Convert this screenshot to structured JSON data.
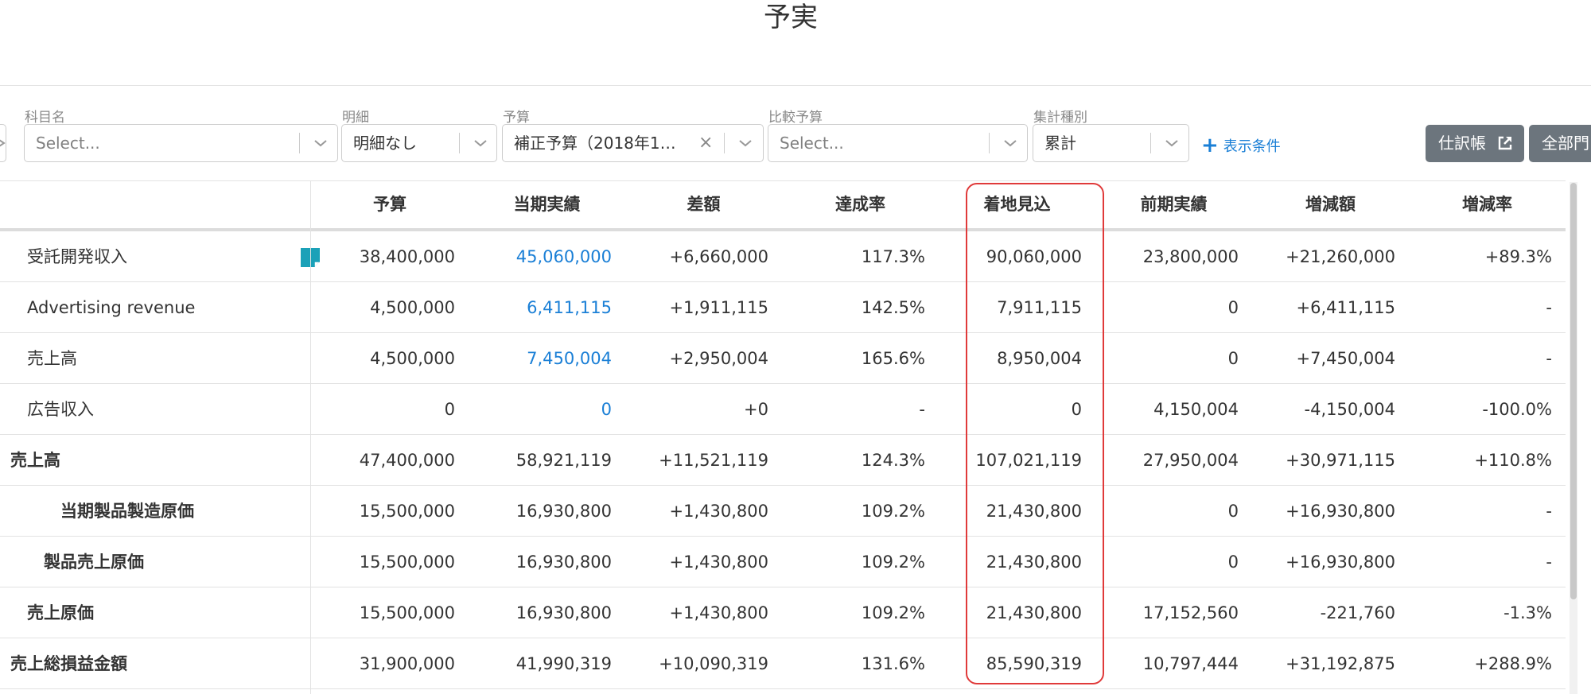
{
  "page": {
    "title": "予実"
  },
  "filters": {
    "account_name": {
      "label": "科目名",
      "placeholder": "Select..."
    },
    "detail": {
      "label": "明細",
      "value": "明細なし"
    },
    "budget": {
      "label": "予算",
      "value": "補正予算（2018年1…"
    },
    "compare_budget": {
      "label": "比較予算",
      "placeholder": "Select..."
    },
    "aggregation": {
      "label": "集計種別",
      "value": "累計"
    },
    "conditions_link": "表示条件"
  },
  "buttons": {
    "journal": "仕訳帳",
    "all_departments": "全部門"
  },
  "table": {
    "columns": [
      "予算",
      "当期実績",
      "差額",
      "達成率",
      "着地見込",
      "前期実績",
      "増減額",
      "増減率"
    ],
    "rows": [
      {
        "name": "受託開発収入",
        "has_note": true,
        "budget": "38,400,000",
        "actual": "45,060,000",
        "actual_link": true,
        "diff": "+6,660,000",
        "rate": "117.3%",
        "forecast": "90,060,000",
        "prev": "23,800,000",
        "change": "+21,260,000",
        "change_rate": "+89.3%"
      },
      {
        "name": "Advertising revenue",
        "budget": "4,500,000",
        "actual": "6,411,115",
        "actual_link": true,
        "diff": "+1,911,115",
        "rate": "142.5%",
        "forecast": "7,911,115",
        "prev": "0",
        "change": "+6,411,115",
        "change_rate": "-"
      },
      {
        "name": "売上高",
        "budget": "4,500,000",
        "actual": "7,450,004",
        "actual_link": true,
        "diff": "+2,950,004",
        "rate": "165.6%",
        "forecast": "8,950,004",
        "prev": "0",
        "change": "+7,450,004",
        "change_rate": "-"
      },
      {
        "name": "広告収入",
        "budget": "0",
        "actual": "0",
        "actual_link": true,
        "diff": "+0",
        "rate": "-",
        "forecast": "0",
        "prev": "4,150,004",
        "change": "-4,150,004",
        "change_rate": "-100.0%"
      },
      {
        "name": "売上高",
        "bold": true,
        "budget": "47,400,000",
        "actual": "58,921,119",
        "diff": "+11,521,119",
        "rate": "124.3%",
        "forecast": "107,021,119",
        "prev": "27,950,004",
        "change": "+30,971,115",
        "change_rate": "+110.8%"
      },
      {
        "name": "当期製品製造原価",
        "bold": true,
        "budget": "15,500,000",
        "actual": "16,930,800",
        "diff": "+1,430,800",
        "rate": "109.2%",
        "forecast": "21,430,800",
        "prev": "0",
        "change": "+16,930,800",
        "change_rate": "-"
      },
      {
        "name": "製品売上原価",
        "bold": true,
        "budget": "15,500,000",
        "actual": "16,930,800",
        "diff": "+1,430,800",
        "rate": "109.2%",
        "forecast": "21,430,800",
        "prev": "0",
        "change": "+16,930,800",
        "change_rate": "-"
      },
      {
        "name": "売上原価",
        "bold": true,
        "budget": "15,500,000",
        "actual": "16,930,800",
        "diff": "+1,430,800",
        "rate": "109.2%",
        "forecast": "21,430,800",
        "prev": "17,152,560",
        "change": "-221,760",
        "change_rate": "-1.3%"
      },
      {
        "name": "売上総損益金額",
        "bold": true,
        "budget": "31,900,000",
        "actual": "41,990,319",
        "diff": "+10,090,319",
        "rate": "131.6%",
        "forecast": "85,590,319",
        "prev": "10,797,444",
        "change": "+31,192,875",
        "change_rate": "+288.9%"
      }
    ]
  },
  "colors": {
    "link": "#1a7fd6",
    "highlight": "#e03a3a",
    "button": "#6c757d",
    "note": "#1ba1b8"
  },
  "icons": {
    "note": "memo-note-icon",
    "external": "external-link-icon",
    "chevron": "chevron-down-icon",
    "clear": "clear-x-icon",
    "plus": "plus-icon"
  }
}
